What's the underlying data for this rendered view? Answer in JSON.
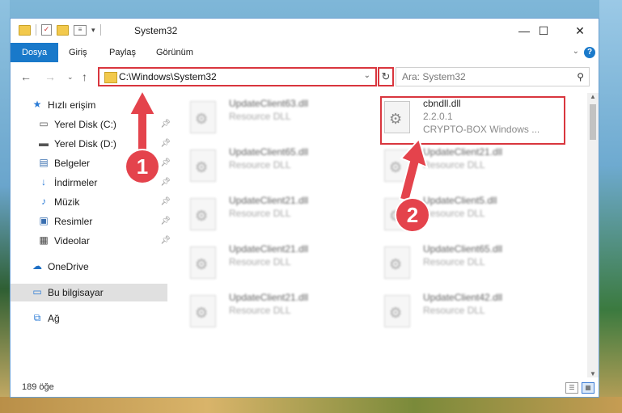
{
  "window": {
    "title": "System32",
    "controls": {
      "minimize": "—",
      "maximize": "☐",
      "close": "✕"
    }
  },
  "ribbon": {
    "tabs": [
      "Dosya",
      "Giriş",
      "Paylaş",
      "Görünüm"
    ],
    "help": "?"
  },
  "navbar": {
    "address": "C:\\Windows\\System32",
    "search_placeholder": "Ara: System32"
  },
  "sidebar": {
    "items": [
      {
        "label": "Hızlı erişim",
        "icon": "star-icon"
      },
      {
        "label": "Yerel Disk (C:)",
        "icon": "drive-icon",
        "pinned": true
      },
      {
        "label": "Yerel Disk (D:)",
        "icon": "drive-icon",
        "pinned": true
      },
      {
        "label": "Belgeler",
        "icon": "documents-icon",
        "pinned": true
      },
      {
        "label": "İndirmeler",
        "icon": "download-icon",
        "pinned": true
      },
      {
        "label": "Müzik",
        "icon": "music-icon",
        "pinned": true
      },
      {
        "label": "Resimler",
        "icon": "pictures-icon",
        "pinned": true
      },
      {
        "label": "Videolar",
        "icon": "videos-icon",
        "pinned": true
      },
      {
        "label": "OneDrive",
        "icon": "cloud-icon"
      },
      {
        "label": "Bu bilgisayar",
        "icon": "computer-icon",
        "selected": true
      },
      {
        "label": "Ağ",
        "icon": "network-icon"
      }
    ]
  },
  "files": {
    "left": [
      {
        "name": "UpdateClient63.dll",
        "type": "Resource DLL"
      },
      {
        "name": "UpdateClient65.dll",
        "type": "Resource DLL"
      },
      {
        "name": "UpdateClient21.dll",
        "type": "Resource DLL"
      },
      {
        "name": "UpdateClient21.dll",
        "type": "Resource DLL"
      },
      {
        "name": "UpdateClient21.dll",
        "type": "Resource DLL"
      }
    ],
    "right": [
      {
        "name": "cbndll.dll",
        "version": "2.2.0.1",
        "type": "CRYPTO-BOX Windows ..."
      },
      {
        "name": "UpdateClient21.dll",
        "type": "Resource DLL"
      },
      {
        "name": "UpdateClient5.dll",
        "type": "Resource DLL"
      },
      {
        "name": "UpdateClient65.dll",
        "type": "Resource DLL"
      },
      {
        "name": "UpdateClient42.dll",
        "type": "Resource DLL"
      }
    ]
  },
  "status": {
    "count": "189 öğe"
  },
  "annotations": {
    "one": "1",
    "two": "2"
  },
  "colors": {
    "accent": "#1979ca",
    "highlight": "#d9363e"
  }
}
